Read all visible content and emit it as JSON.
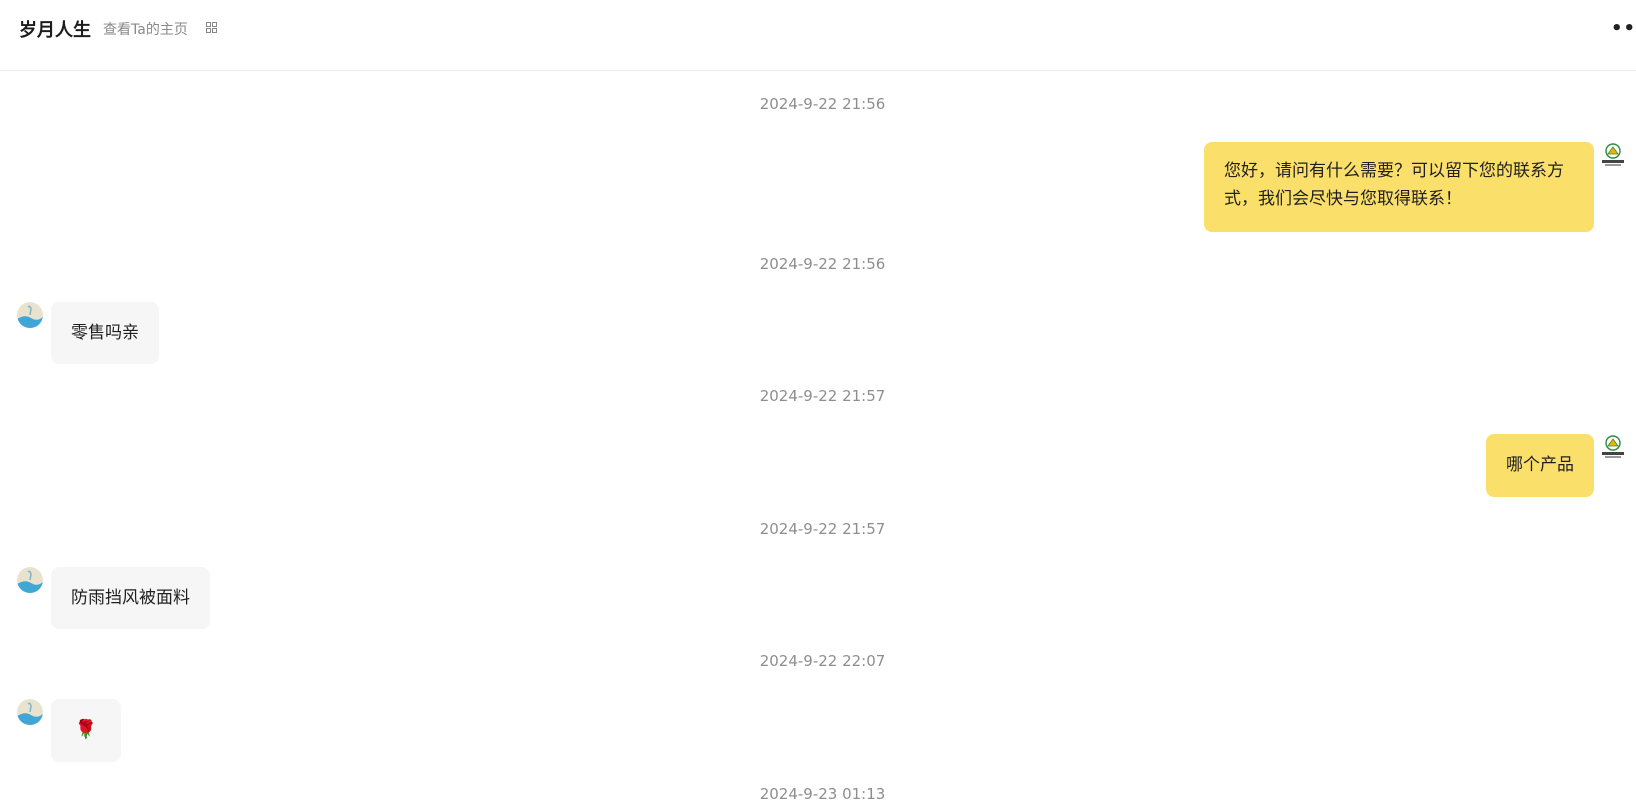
{
  "header": {
    "name": "岁月人生",
    "profile_link": "查看Ta的主页",
    "more_glyph": "••"
  },
  "messages": [
    {
      "time": "2024-9-22 21:56",
      "side": "out",
      "text": "您好，请问有什么需要？可以留下您的联系方式，我们会尽快与您取得联系！"
    },
    {
      "time": "2024-9-22 21:56",
      "side": "in",
      "text": "零售吗亲"
    },
    {
      "time": "2024-9-22 21:57",
      "side": "out",
      "text": "哪个产品"
    },
    {
      "time": "2024-9-22 21:57",
      "side": "in",
      "text": "防雨挡风被面料"
    },
    {
      "time": "2024-9-22 22:07",
      "side": "in",
      "text": "🌹"
    },
    {
      "time": "2024-9-23 01:13"
    }
  ],
  "colors": {
    "outgoing_bubble": "#fadf6b",
    "incoming_bubble": "#f6f6f6",
    "timestamp": "#8e8e8e"
  }
}
